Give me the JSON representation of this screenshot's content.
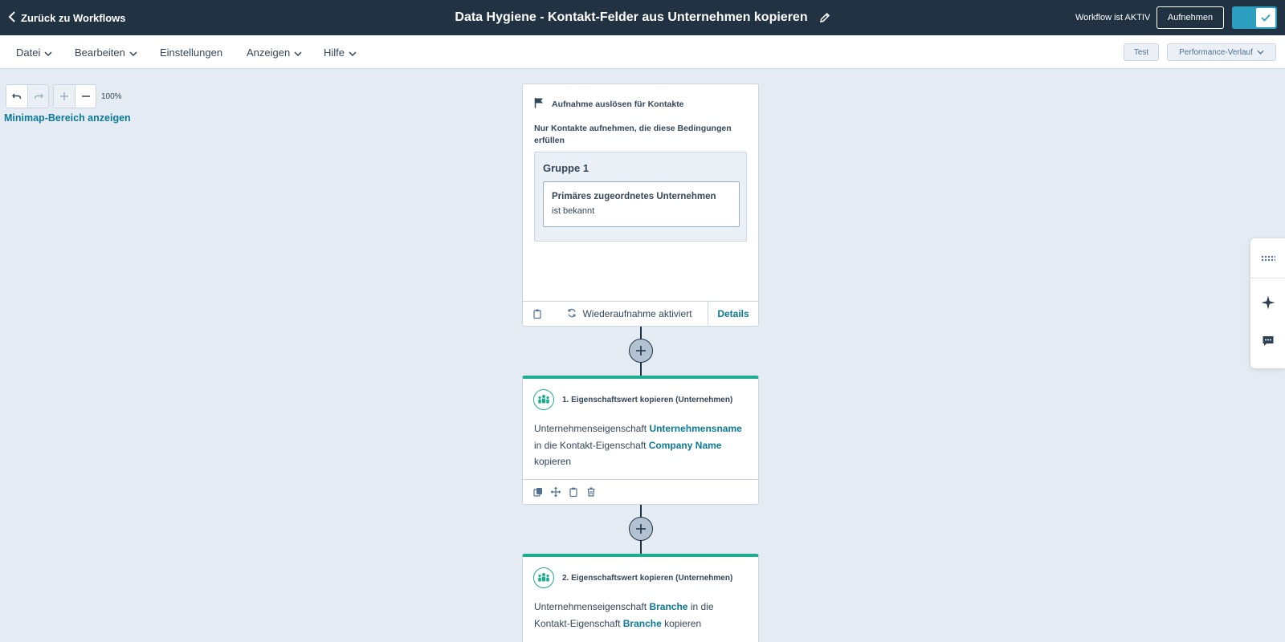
{
  "header": {
    "back_label": "Zurück zu Workflows",
    "workflow_title": "Data Hygiene - Kontakt-Felder aus Unternehmen kopieren",
    "status_text": "Workflow ist AKTIV",
    "enroll_button": "Aufnehmen",
    "active": true
  },
  "menu": {
    "items": [
      {
        "label": "Datei",
        "has_dropdown": true
      },
      {
        "label": "Bearbeiten",
        "has_dropdown": true
      },
      {
        "label": "Einstellungen",
        "has_dropdown": false
      },
      {
        "label": "Anzeigen",
        "has_dropdown": true
      },
      {
        "label": "Hilfe",
        "has_dropdown": true
      }
    ],
    "test_button": "Test",
    "performance_button": "Performance-Verlauf"
  },
  "canvas": {
    "zoom": "100%",
    "minimap_link": "Minimap-Bereich anzeigen"
  },
  "trigger": {
    "title": "Aufnahme auslösen für Kontakte",
    "subtitle": "Nur Kontakte aufnehmen, die diese Bedingungen erfüllen",
    "group_title": "Gruppe 1",
    "condition_property": "Primäres zugeordnetes Unternehmen",
    "condition_operator": "ist bekannt",
    "reenroll_text": "Wiederaufnahme aktiviert",
    "details_link": "Details"
  },
  "actions": [
    {
      "title": "1. Eigenschaftswert kopieren (Unternehmen)",
      "text_1": "Unternehmenseigenschaft",
      "source_property": "Unternehmensname",
      "text_2": "in die Kontakt-Eigenschaft",
      "target_property": "Company Name",
      "text_3": "kopieren"
    },
    {
      "title": "2. Eigenschaftswert kopieren (Unternehmen)",
      "text_1": "Unternehmenseigenschaft",
      "source_property": "Branche",
      "text_2": "in die Kontakt-Eigenschaft",
      "target_property": "Branche",
      "text_3": "kopieren"
    }
  ],
  "colors": {
    "header_bg": "#213343",
    "accent_teal": "#1fad92",
    "link_blue": "#0b7a99",
    "toggle_blue": "#2c9fc1",
    "canvas_bg": "#e5ebf2"
  },
  "icons": {
    "back": "chevron-left-icon",
    "edit": "pencil-icon",
    "toggle": "check-icon",
    "undo": "undo-icon",
    "redo": "redo-icon",
    "zoom_in": "plus-icon",
    "zoom_out": "minus-icon",
    "trigger": "flag-icon",
    "copy": "clipboard-icon",
    "reenroll": "refresh-icon",
    "add_step": "plus-circle-icon",
    "action": "company-people-icon",
    "clone": "clone-icon",
    "move": "move-icon",
    "delete": "trash-icon",
    "apps": "grid-dots-icon",
    "ai": "sparkle-icon",
    "chat": "chat-icon"
  }
}
